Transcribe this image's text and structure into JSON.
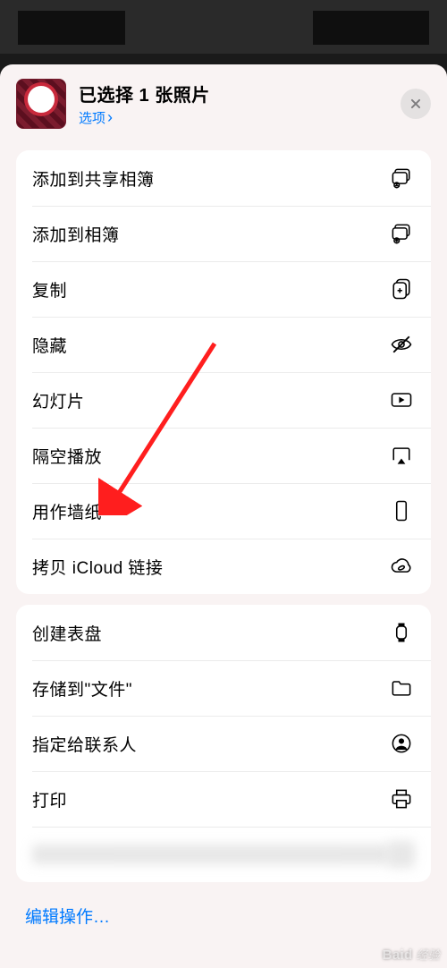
{
  "header": {
    "title": "已选择 1 张照片",
    "options_label": "选项"
  },
  "sections": [
    {
      "items": [
        {
          "label": "添加到共享相簿",
          "icon": "shared-album-icon"
        },
        {
          "label": "添加到相簿",
          "icon": "album-add-icon"
        },
        {
          "label": "复制",
          "icon": "duplicate-icon"
        },
        {
          "label": "隐藏",
          "icon": "eye-slash-icon"
        },
        {
          "label": "幻灯片",
          "icon": "play-rect-icon"
        },
        {
          "label": "隔空播放",
          "icon": "airplay-icon"
        },
        {
          "label": "用作墙纸",
          "icon": "wallpaper-icon"
        },
        {
          "label": "拷贝 iCloud 链接",
          "icon": "icloud-link-icon"
        }
      ]
    },
    {
      "items": [
        {
          "label": "创建表盘",
          "icon": "watch-icon"
        },
        {
          "label": "存储到\"文件\"",
          "icon": "folder-icon"
        },
        {
          "label": "指定给联系人",
          "icon": "contact-icon"
        },
        {
          "label": "打印",
          "icon": "print-icon"
        },
        {
          "label": "",
          "icon": "",
          "redacted": true
        }
      ]
    }
  ],
  "footer": {
    "edit_actions": "编辑操作…"
  },
  "annotation": {
    "arrow_target": "用作墙纸",
    "arrow_color": "#ff1e1e"
  },
  "watermark": {
    "brand": "Baid",
    "text": "经验"
  }
}
